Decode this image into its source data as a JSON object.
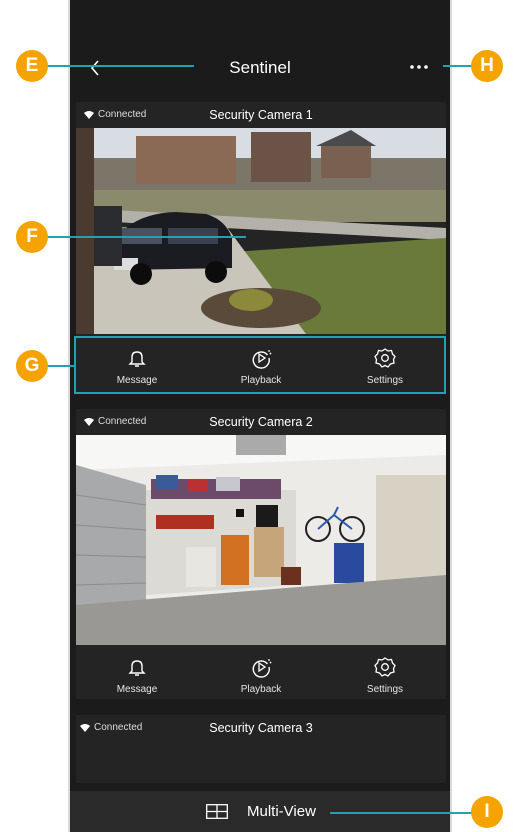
{
  "app": {
    "title": "Sentinel"
  },
  "cameras": [
    {
      "name": "Security Camera 1",
      "status": "Connected"
    },
    {
      "name": "Security Camera 2",
      "status": "Connected"
    },
    {
      "name": "Security Camera 3",
      "status": "Connected"
    }
  ],
  "actions": {
    "message": "Message",
    "playback": "Playback",
    "settings": "Settings"
  },
  "bottom_bar": {
    "label": "Multi-View"
  },
  "callouts": {
    "e": "E",
    "f": "F",
    "g": "G",
    "h": "H",
    "i": "I"
  },
  "colors": {
    "accent": "#21a2b1",
    "callout": "#f4a300",
    "background": "#1b1b1b"
  }
}
